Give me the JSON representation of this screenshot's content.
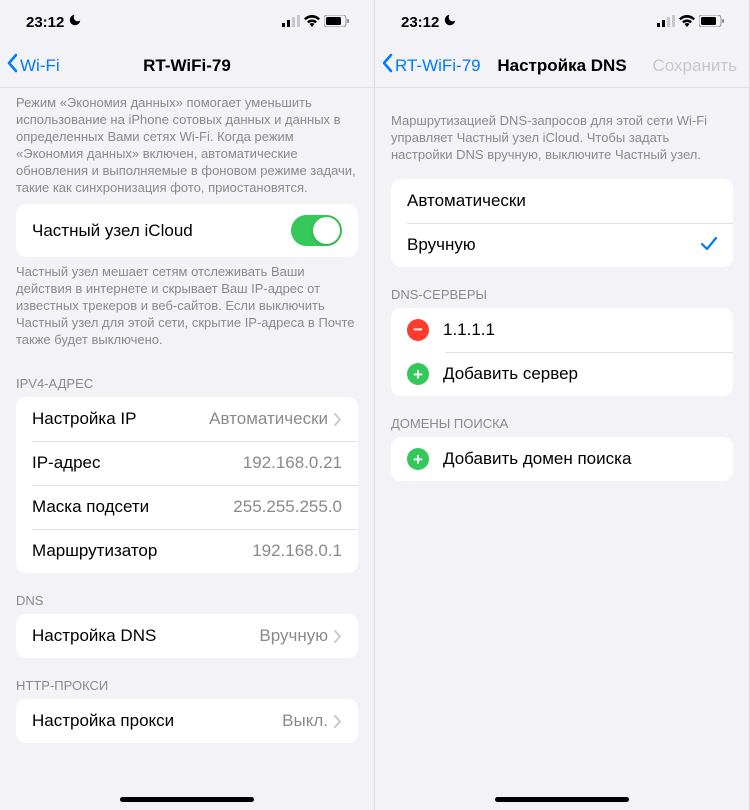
{
  "status": {
    "time": "23:12"
  },
  "left": {
    "nav_back": "Wi-Fi",
    "nav_title": "RT-WiFi-79",
    "data_saver_footer": "Режим «Экономия данных» помогает уменьшить использование на iPhone сотовых данных и данных в определенных Вами сетях Wi-Fi. Когда режим «Экономия данных» включен, автоматические обновления и выполняемые в фоновом режиме задачи, такие как синхронизация фото, приостановятся.",
    "private_relay_label": "Частный узел iCloud",
    "private_relay_footer": "Частный узел мешает сетям отслеживать Ваши действия в интернете и скрывает Ваш IP-адрес от известных трекеров и веб-сайтов. Если выключить Частный узел для этой сети, скрытие IP-адреса в Почте также будет выключено.",
    "ipv4_header": "IPV4-АДРЕС",
    "ip_config_label": "Настройка IP",
    "ip_config_value": "Автоматически",
    "ip_address_label": "IP-адрес",
    "ip_address_value": "192.168.0.21",
    "subnet_label": "Маска подсети",
    "subnet_value": "255.255.255.0",
    "router_label": "Маршрутизатор",
    "router_value": "192.168.0.1",
    "dns_header": "DNS",
    "dns_config_label": "Настройка DNS",
    "dns_config_value": "Вручную",
    "proxy_header": "HTTP-ПРОКСИ",
    "proxy_config_label": "Настройка прокси",
    "proxy_config_value": "Выкл."
  },
  "right": {
    "nav_back": "RT-WiFi-79",
    "nav_title": "Настройка DNS",
    "nav_action": "Сохранить",
    "intro_footer": "Маршрутизацией DNS-запросов для этой сети Wi-Fi управляет Частный узел iCloud. Чтобы задать настройки DNS вручную, выключите Частный узел.",
    "mode_auto": "Автоматически",
    "mode_manual": "Вручную",
    "dns_servers_header": "DNS-СЕРВЕРЫ",
    "server1": "1.1.1.1",
    "add_server": "Добавить сервер",
    "search_domains_header": "ДОМЕНЫ ПОИСКА",
    "add_domain": "Добавить домен поиска"
  }
}
